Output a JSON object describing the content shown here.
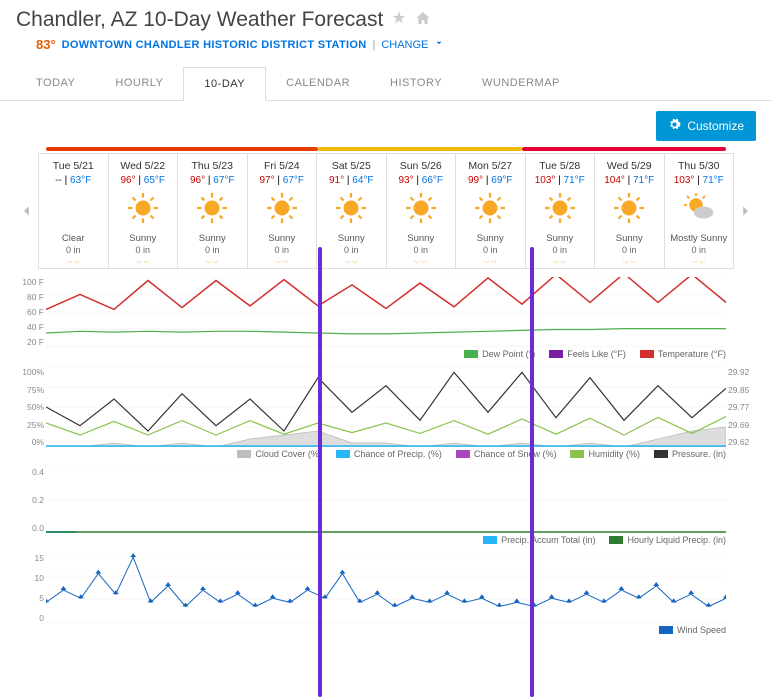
{
  "header": {
    "title": "Chandler, AZ 10-Day Weather Forecast",
    "current_temp": "83°",
    "station": "DOWNTOWN CHANDLER HISTORIC DISTRICT STATION",
    "change": "CHANGE"
  },
  "tabs": [
    {
      "label": "TODAY",
      "active": false
    },
    {
      "label": "HOURLY",
      "active": false
    },
    {
      "label": "10-DAY",
      "active": true
    },
    {
      "label": "CALENDAR",
      "active": false
    },
    {
      "label": "HISTORY",
      "active": false
    },
    {
      "label": "WUNDERMAP",
      "active": false
    }
  ],
  "customize": "Customize",
  "days": [
    {
      "date": "Tue 5/21",
      "hi": "--",
      "lo": "63°F",
      "icon": "moon",
      "cond": "Clear",
      "precip": "0 in"
    },
    {
      "date": "Wed 5/22",
      "hi": "96°",
      "lo": "65°F",
      "icon": "sun",
      "cond": "Sunny",
      "precip": "0 in"
    },
    {
      "date": "Thu 5/23",
      "hi": "96°",
      "lo": "67°F",
      "icon": "sun",
      "cond": "Sunny",
      "precip": "0 in"
    },
    {
      "date": "Fri 5/24",
      "hi": "97°",
      "lo": "67°F",
      "icon": "sun",
      "cond": "Sunny",
      "precip": "0 in"
    },
    {
      "date": "Sat 5/25",
      "hi": "91°",
      "lo": "64°F",
      "icon": "sun",
      "cond": "Sunny",
      "precip": "0 in"
    },
    {
      "date": "Sun 5/26",
      "hi": "93°",
      "lo": "66°F",
      "icon": "sun",
      "cond": "Sunny",
      "precip": "0 in"
    },
    {
      "date": "Mon 5/27",
      "hi": "99°",
      "lo": "69°F",
      "icon": "sun",
      "cond": "Sunny",
      "precip": "0 in"
    },
    {
      "date": "Tue 5/28",
      "hi": "103°",
      "lo": "71°F",
      "icon": "sun",
      "cond": "Sunny",
      "precip": "0 in"
    },
    {
      "date": "Wed 5/29",
      "hi": "104°",
      "lo": "71°F",
      "icon": "sun",
      "cond": "Sunny",
      "precip": "0 in"
    },
    {
      "date": "Thu 5/30",
      "hi": "103°",
      "lo": "71°F",
      "icon": "psun",
      "cond": "Mostly Sunny",
      "precip": "0 in"
    }
  ],
  "y_temp": [
    "100 F",
    "80 F",
    "60 F",
    "40 F",
    "20 F"
  ],
  "y_pct": [
    "100%",
    "75%",
    "50%",
    "25%",
    "0%"
  ],
  "y_press": [
    "29.92",
    "29.85",
    "29.77",
    "29.69",
    "29.62"
  ],
  "y_precip": [
    "0.4",
    "0.2",
    "0.0"
  ],
  "y_wind": [
    "15",
    "10",
    "5",
    "0"
  ],
  "legends": {
    "temp": [
      {
        "label": "Dew Point (°)",
        "color": "#4caf50"
      },
      {
        "label": "Feels Like (°F)",
        "color": "#7b1fa2"
      },
      {
        "label": "Temperature (°F)",
        "color": "#d32f2f"
      }
    ],
    "mid": [
      {
        "label": "Cloud Cover (%)",
        "color": "#bdbdbd"
      },
      {
        "label": "Chance of Precip. (%)",
        "color": "#29b6f6"
      },
      {
        "label": "Chance of Snow (%)",
        "color": "#ab47bc"
      },
      {
        "label": "Humidity (%)",
        "color": "#8bc34a"
      },
      {
        "label": "Pressure. (in)",
        "color": "#333"
      }
    ],
    "precip": [
      {
        "label": "Precip. Accum Total (in)",
        "color": "#29b6f6"
      },
      {
        "label": "Hourly Liquid Precip. (in)",
        "color": "#2e7d32"
      }
    ],
    "wind": [
      {
        "label": "Wind Speed",
        "color": "#1565c0"
      }
    ]
  },
  "chart_data": {
    "temperature": {
      "type": "line",
      "ylim": [
        20,
        100
      ],
      "series": [
        {
          "name": "Temperature (°F)",
          "data": [
            63,
            80,
            63,
            96,
            65,
            96,
            67,
            97,
            67,
            91,
            64,
            93,
            66,
            99,
            69,
            103,
            71,
            104,
            71,
            103,
            71
          ]
        },
        {
          "name": "Dew Point (°)",
          "data": [
            36,
            38,
            37,
            38,
            37,
            38,
            38,
            37,
            36,
            35,
            35,
            36,
            37,
            38,
            39,
            40,
            40,
            41,
            41,
            41,
            41
          ]
        }
      ]
    },
    "humidity_pressure": {
      "type": "line",
      "ylim_left": [
        0,
        100
      ],
      "ylim_right": [
        29.62,
        29.92
      ],
      "series": [
        {
          "name": "Humidity (%)",
          "data": [
            30,
            15,
            32,
            15,
            33,
            15,
            33,
            16,
            30,
            18,
            30,
            17,
            33,
            16,
            35,
            16,
            36,
            15,
            37,
            17,
            38
          ]
        },
        {
          "name": "Pressure (in)",
          "data": [
            29.77,
            29.7,
            29.8,
            29.68,
            29.82,
            29.7,
            29.8,
            29.68,
            29.88,
            29.75,
            29.85,
            29.72,
            29.9,
            29.75,
            29.9,
            29.73,
            29.88,
            29.72,
            29.85,
            29.73,
            29.84
          ]
        },
        {
          "name": "Cloud Cover (%)",
          "data": [
            0,
            0,
            5,
            0,
            5,
            0,
            10,
            15,
            20,
            5,
            5,
            0,
            5,
            0,
            5,
            0,
            5,
            0,
            10,
            20,
            25
          ]
        },
        {
          "name": "Chance of Precip (%)",
          "data": [
            0,
            0,
            0,
            0,
            0,
            0,
            0,
            0,
            0,
            0,
            0,
            0,
            0,
            0,
            0,
            0,
            0,
            0,
            0,
            0,
            0
          ]
        }
      ]
    },
    "precip_accum": {
      "type": "line",
      "ylim": [
        0,
        0.4
      ],
      "series": [
        {
          "name": "Precip Accum Total (in)",
          "data": [
            0,
            0,
            0,
            0,
            0,
            0,
            0,
            0,
            0,
            0
          ]
        },
        {
          "name": "Hourly Liquid Precip (in)",
          "data": [
            0,
            0,
            0,
            0,
            0,
            0,
            0,
            0,
            0,
            0
          ]
        }
      ]
    },
    "wind": {
      "type": "line",
      "ylim": [
        0,
        17
      ],
      "data": [
        5,
        8,
        6,
        12,
        7,
        16,
        5,
        9,
        4,
        8,
        5,
        7,
        4,
        6,
        5,
        8,
        6,
        12,
        5,
        7,
        4,
        6,
        5,
        7,
        5,
        6,
        4,
        5,
        4,
        6,
        5,
        7,
        5,
        8,
        6,
        9,
        5,
        7,
        4,
        6
      ]
    }
  }
}
